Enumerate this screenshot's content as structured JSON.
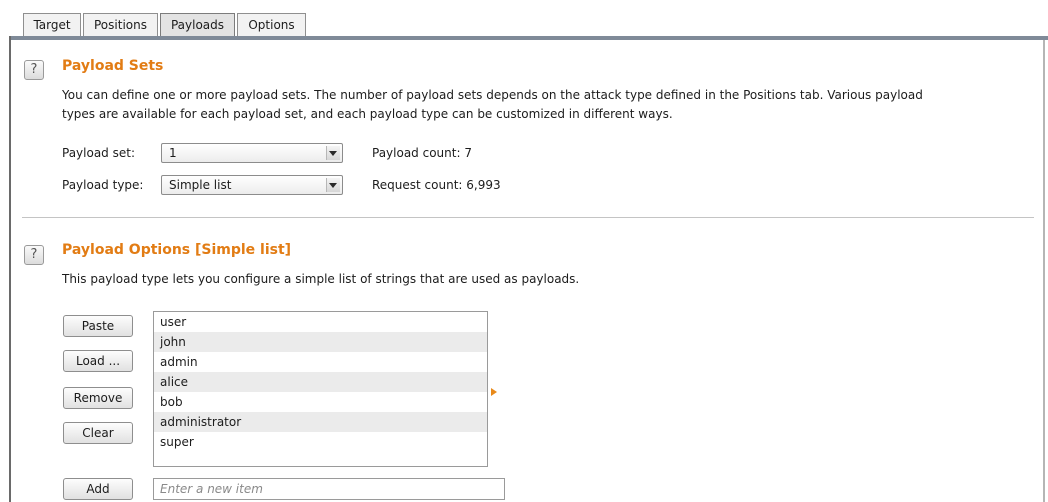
{
  "tabs": [
    {
      "label": "Target"
    },
    {
      "label": "Positions"
    },
    {
      "label": "Payloads",
      "active": true
    },
    {
      "label": "Options"
    }
  ],
  "payload_sets": {
    "help_icon": "question-mark-icon",
    "title": "Payload Sets",
    "description_line1": "You can define one or more payload sets. The number of payload sets depends on the attack type defined in the Positions tab. Various payload",
    "description_line2": "types are available for each payload set, and each payload type can be customized in different ways.",
    "set_label": "Payload set:",
    "set_value": "1",
    "type_label": "Payload type:",
    "type_value": "Simple list",
    "payload_count": "Payload count: 7",
    "request_count": "Request count: 6,993"
  },
  "payload_options": {
    "help_icon": "question-mark-icon",
    "title": "Payload Options [Simple list]",
    "description": "This payload type lets you configure a simple list of strings that are used as payloads.",
    "buttons": {
      "paste": "Paste",
      "load": "Load ...",
      "remove": "Remove",
      "clear": "Clear",
      "add": "Add"
    },
    "items": [
      "user",
      "john",
      "admin",
      "alice",
      "bob",
      "administrator",
      "super"
    ],
    "add_placeholder": "Enter a new item"
  },
  "colors": {
    "heading": "#e27c14",
    "accent_arrow": "#e8891a"
  }
}
